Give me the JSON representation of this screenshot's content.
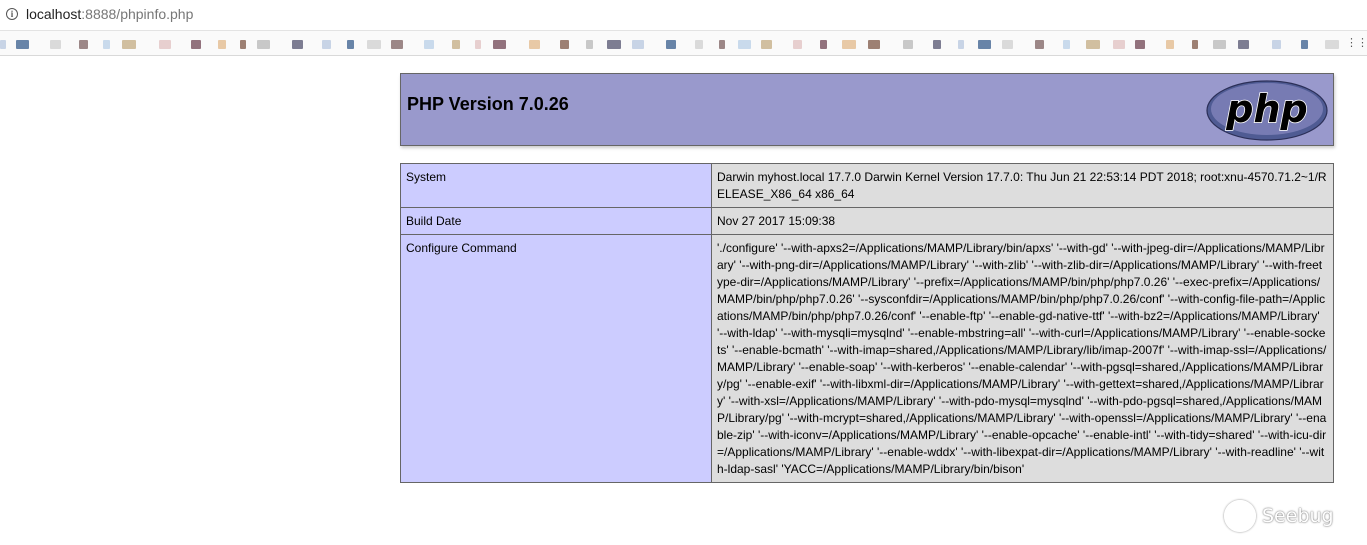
{
  "browser": {
    "url_host": "localhost",
    "url_rest": ":8888/phpinfo.php"
  },
  "php": {
    "title": "PHP Version 7.0.26",
    "logo_text": "php"
  },
  "info_rows": [
    {
      "key": "System",
      "value": "Darwin myhost.local 17.7.0 Darwin Kernel Version 17.7.0: Thu Jun 21 22:53:14 PDT 2018; root:xnu-4570.71.2~1/RELEASE_X86_64 x86_64"
    },
    {
      "key": "Build Date",
      "value": "Nov 27 2017 15:09:38"
    },
    {
      "key": "Configure Command",
      "value": "'./configure' '--with-apxs2=/Applications/MAMP/Library/bin/apxs' '--with-gd' '--with-jpeg-dir=/Applications/MAMP/Library' '--with-png-dir=/Applications/MAMP/Library' '--with-zlib' '--with-zlib-dir=/Applications/MAMP/Library' '--with-freetype-dir=/Applications/MAMP/Library' '--prefix=/Applications/MAMP/bin/php/php7.0.26' '--exec-prefix=/Applications/MAMP/bin/php/php7.0.26' '--sysconfdir=/Applications/MAMP/bin/php/php7.0.26/conf' '--with-config-file-path=/Applications/MAMP/bin/php/php7.0.26/conf' '--enable-ftp' '--enable-gd-native-ttf' '--with-bz2=/Applications/MAMP/Library' '--with-ldap' '--with-mysqli=mysqlnd' '--enable-mbstring=all' '--with-curl=/Applications/MAMP/Library' '--enable-sockets' '--enable-bcmath' '--with-imap=shared,/Applications/MAMP/Library/lib/imap-2007f' '--with-imap-ssl=/Applications/MAMP/Library' '--enable-soap' '--with-kerberos' '--enable-calendar' '--with-pgsql=shared,/Applications/MAMP/Library/pg' '--enable-exif' '--with-libxml-dir=/Applications/MAMP/Library' '--with-gettext=shared,/Applications/MAMP/Library' '--with-xsl=/Applications/MAMP/Library' '--with-pdo-mysql=mysqlnd' '--with-pdo-pgsql=shared,/Applications/MAMP/Library/pg' '--with-mcrypt=shared,/Applications/MAMP/Library' '--with-openssl=/Applications/MAMP/Library' '--enable-zip' '--with-iconv=/Applications/MAMP/Library' '--enable-opcache' '--enable-intl' '--with-tidy=shared' '--with-icu-dir=/Applications/MAMP/Library' '--enable-wddx' '--with-libexpat-dir=/Applications/MAMP/Library' '--with-readline' '--with-ldap-sasl' 'YACC=/Applications/MAMP/Library/bin/bison'"
    }
  ],
  "watermark": {
    "text": "Seebug"
  },
  "colors": {
    "header_bg": "#9999cc",
    "key_bg": "#ccccff",
    "value_bg": "#dddddd",
    "logo_bg": "#6c74b4"
  }
}
